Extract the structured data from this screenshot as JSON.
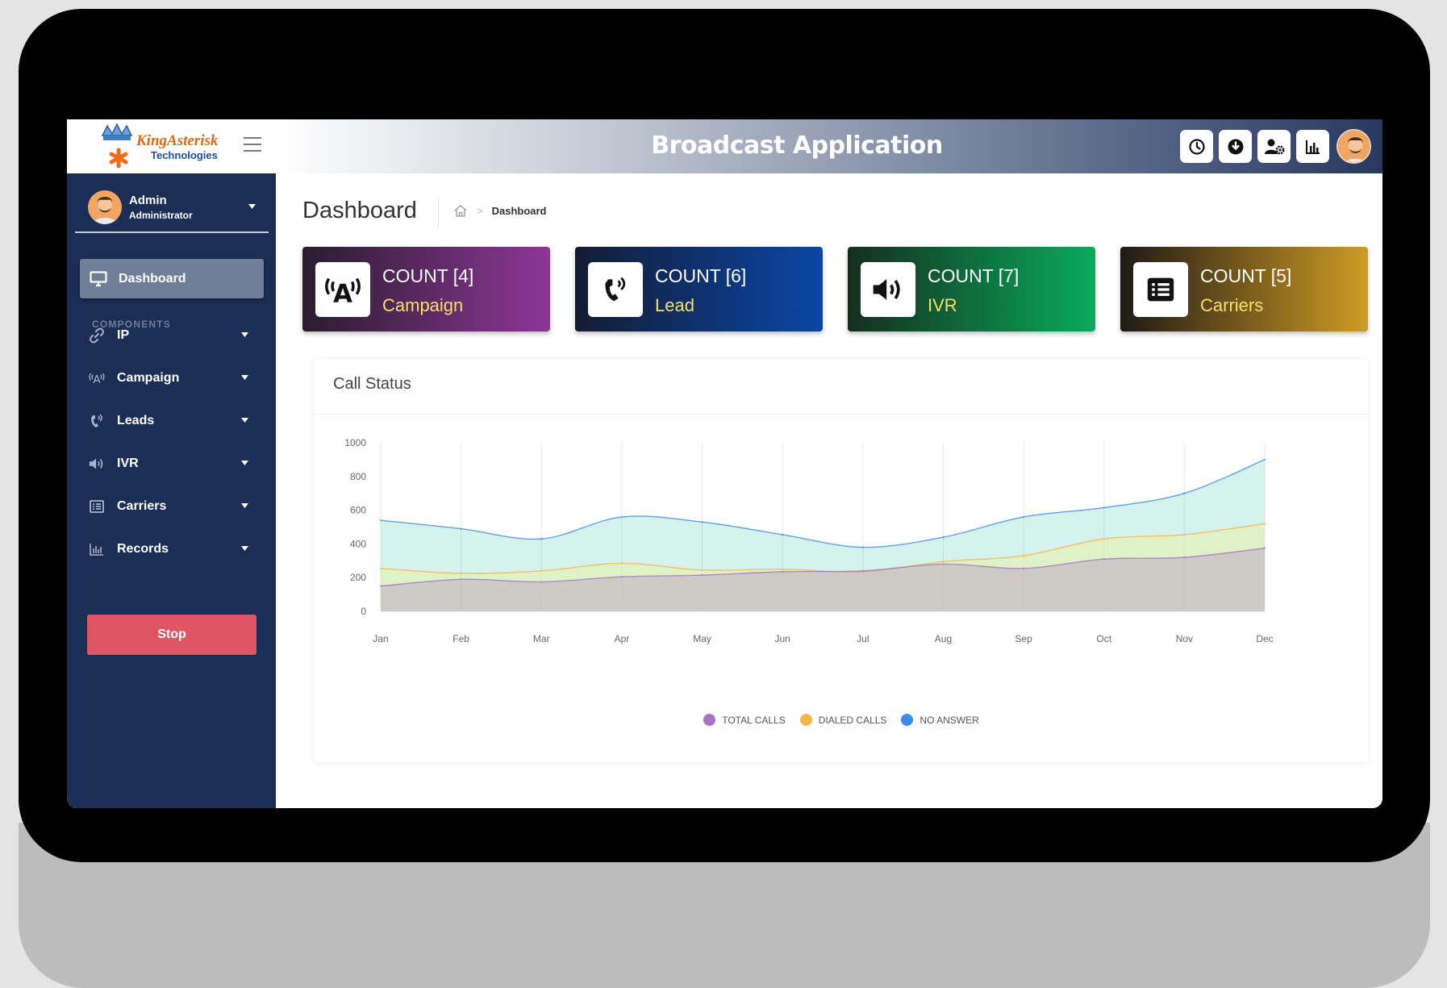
{
  "header": {
    "logo_main": "KingAsterisk",
    "logo_sub": "Technologies",
    "title": "Broadcast Application",
    "icons": [
      "clock-icon",
      "download-icon",
      "user-settings-icon",
      "bar-chart-icon",
      "profile-avatar"
    ]
  },
  "sidebar": {
    "user_name": "Admin",
    "user_role": "Administrator",
    "active_item": "Dashboard",
    "section_title": "COMPONENTS",
    "items": [
      {
        "label": "IP",
        "icon": "link-icon"
      },
      {
        "label": "Campaign",
        "icon": "broadcast-icon"
      },
      {
        "label": "Leads",
        "icon": "phone-icon"
      },
      {
        "label": "IVR",
        "icon": "volume-icon"
      },
      {
        "label": "Carriers",
        "icon": "list-icon"
      },
      {
        "label": "Records",
        "icon": "bar-chart-icon"
      }
    ],
    "stop_label": "Stop"
  },
  "page": {
    "title": "Dashboard",
    "breadcrumb": "Dashboard"
  },
  "cards": [
    {
      "count": "COUNT [4]",
      "name": "Campaign",
      "icon": "broadcast-icon",
      "gradient": [
        "#2a1d2e",
        "#8d3697"
      ]
    },
    {
      "count": "COUNT [6]",
      "name": "Lead",
      "icon": "phone-icon",
      "gradient": [
        "#141c33",
        "#0a46a8"
      ]
    },
    {
      "count": "COUNT [7]",
      "name": "IVR",
      "icon": "volume-icon",
      "gradient": [
        "#152e1e",
        "#09ab5c"
      ]
    },
    {
      "count": "COUNT [5]",
      "name": "Carriers",
      "icon": "list-icon",
      "gradient": [
        "#1f1a16",
        "#cf9c24"
      ]
    }
  ],
  "chart": {
    "title": "Call Status"
  },
  "chart_data": {
    "type": "area",
    "categories": [
      "Jan",
      "Feb",
      "Mar",
      "Apr",
      "May",
      "Jun",
      "Jul",
      "Aug",
      "Sep",
      "Oct",
      "Nov",
      "Dec"
    ],
    "ylim": [
      0,
      1000
    ],
    "yticks": [
      0,
      200,
      400,
      600,
      800,
      1000
    ],
    "grid": "vertical",
    "legend_position": "bottom",
    "series": [
      {
        "name": "TOTAL CALLS",
        "color": "#a774c4",
        "values": [
          150,
          190,
          175,
          205,
          215,
          235,
          240,
          280,
          255,
          310,
          320,
          375
        ]
      },
      {
        "name": "DIALED CALLS",
        "color": "#f8b34a",
        "values": [
          255,
          225,
          240,
          285,
          245,
          250,
          235,
          295,
          330,
          430,
          455,
          520
        ]
      },
      {
        "name": "NO ANSWER",
        "color": "#3b8de6",
        "values": [
          540,
          490,
          430,
          560,
          530,
          455,
          380,
          440,
          560,
          615,
          700,
          900
        ]
      }
    ]
  }
}
